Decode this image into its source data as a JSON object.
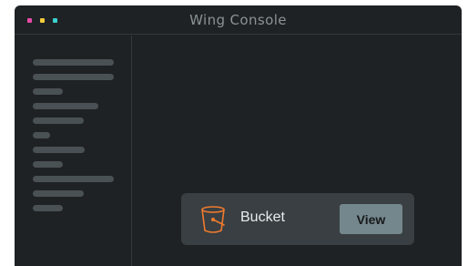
{
  "window": {
    "title": "Wing Console",
    "controls": [
      {
        "name": "close",
        "color": "#e84aa8"
      },
      {
        "name": "minimize",
        "color": "#f2cb3a"
      },
      {
        "name": "maximize",
        "color": "#3ad1cf"
      }
    ]
  },
  "colors": {
    "background": "#1f2224",
    "card": "#393f42",
    "accent": "#f07a2e",
    "button": "#74878d"
  },
  "resource_card": {
    "icon": "bucket-icon",
    "label": "Bucket",
    "action_label": "View"
  }
}
